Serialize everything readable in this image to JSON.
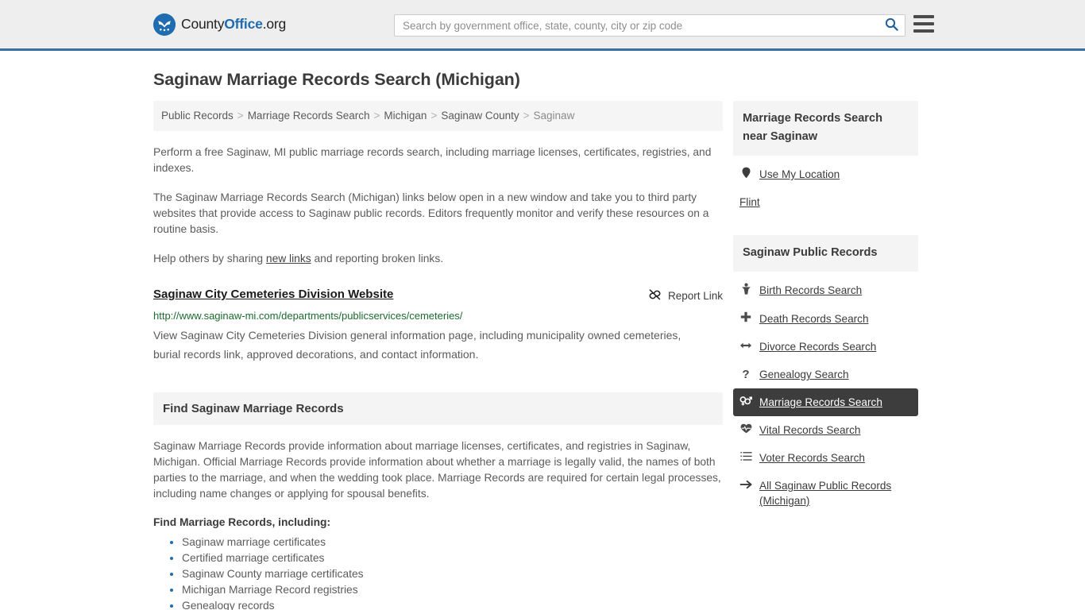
{
  "header": {
    "brand": {
      "part1": "County",
      "part2": "Office",
      "part3": ".org",
      "icon": "eagle-seal-icon"
    },
    "search": {
      "placeholder": "Search by government office, state, county, city or zip code",
      "value": "",
      "search_icon": "search-icon"
    },
    "menu_icon": "hamburger-menu-icon",
    "accent_color": "#3a6ea5"
  },
  "page": {
    "title": "Saginaw Marriage Records Search (Michigan)"
  },
  "breadcrumb": {
    "items": [
      {
        "label": "Public Records",
        "current": false
      },
      {
        "label": "Marriage Records Search",
        "current": false
      },
      {
        "label": "Michigan",
        "current": false
      },
      {
        "label": "Saginaw County",
        "current": false
      },
      {
        "label": "Saginaw",
        "current": true
      }
    ],
    "separator": ">"
  },
  "intro": {
    "p1": "Perform a free Saginaw, MI public marriage records search, including marriage licenses, certificates, registries, and indexes.",
    "p2": "The Saginaw Marriage Records Search (Michigan) links below open in a new window and take you to third party websites that provide access to Saginaw public records. Editors frequently monitor and verify these resources on a routine basis.",
    "p3_before": "Help others by sharing ",
    "p3_link": "new links",
    "p3_after": " and reporting broken links."
  },
  "result": {
    "title": "Saginaw City Cemeteries Division Website",
    "url": "http://www.saginaw-mi.com/departments/publicservices/cemeteries/",
    "description": "View Saginaw City Cemeteries Division general information page, including municipality owned cemeteries, burial records link, approved decorations, and contact information.",
    "report_label": "Report Link",
    "report_icon": "broken-link-icon",
    "url_color": "#1a6b2c"
  },
  "find_section": {
    "heading": "Find Saginaw Marriage Records",
    "paragraph": "Saginaw Marriage Records provide information about marriage licenses, certificates, and registries in Saginaw, Michigan. Official Marriage Records provide information about whether a marriage is legally valid, the names of both parties to the marriage, and when the wedding took place. Marriage Records are required for certain legal processes, including name changes or applying for spousal benefits.",
    "list_heading": "Find Marriage Records, including:",
    "list_items": [
      "Saginaw marriage certificates",
      "Certified marriage certificates",
      "Saginaw County marriage certificates",
      "Michigan Marriage Record registries",
      "Genealogy records"
    ]
  },
  "sidebar": {
    "near_panel": {
      "heading": "Marriage Records Search near Saginaw",
      "items": [
        {
          "label": "Use My Location",
          "icon": "map-pin-icon",
          "has_icon": true
        },
        {
          "label": "Flint",
          "icon": "",
          "has_icon": false
        }
      ]
    },
    "records_panel": {
      "heading": "Saginaw Public Records",
      "active_bg": "#3d3d3d",
      "items": [
        {
          "label": "Birth Records Search",
          "icon": "baby-icon",
          "glyph": "Ɔ",
          "active": false
        },
        {
          "label": "Death Records Search",
          "icon": "cross-icon",
          "glyph": "✚",
          "active": false
        },
        {
          "label": "Divorce Records Search",
          "icon": "arrows-left-right-icon",
          "glyph": "↔",
          "active": false
        },
        {
          "label": "Genealogy Search",
          "icon": "question-mark-icon",
          "glyph": "?",
          "active": false
        },
        {
          "label": "Marriage Records Search",
          "icon": "venus-mars-icon",
          "glyph": "⚥",
          "active": true
        },
        {
          "label": "Vital Records Search",
          "icon": "heartbeat-icon",
          "glyph": "♥",
          "active": false
        },
        {
          "label": "Voter Records Search",
          "icon": "list-ol-icon",
          "glyph": "≡",
          "active": false
        },
        {
          "label": "All Saginaw Public Records (Michigan)",
          "icon": "arrow-right-icon",
          "glyph": "→",
          "active": false
        }
      ]
    }
  }
}
